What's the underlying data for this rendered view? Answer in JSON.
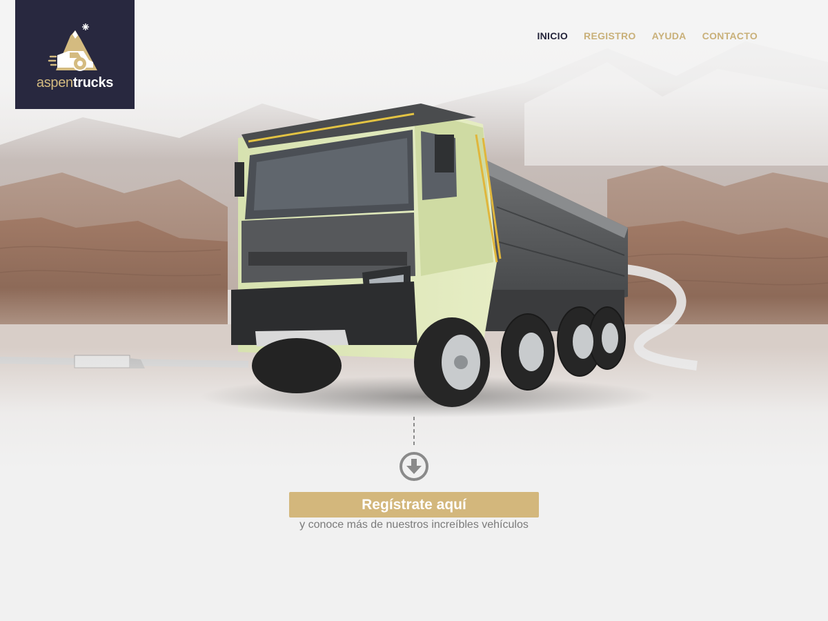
{
  "brand": {
    "name_part1": "aspen",
    "name_part2": "trucks",
    "logo_bg": "#28283f",
    "accent": "#d3b77c"
  },
  "nav": {
    "items": [
      {
        "label": "INICIO",
        "active": true
      },
      {
        "label": "REGISTRO",
        "active": false
      },
      {
        "label": "AYUDA",
        "active": false
      },
      {
        "label": "CONTACTO",
        "active": false
      }
    ]
  },
  "hero": {
    "image": "dump-truck-desert-canyon-photo",
    "scroll_icon": "arrow-down-circle-icon"
  },
  "cta": {
    "button_label": "Regístrate aquí",
    "subtitle": "y conoce más de nuestros increíbles vehículos"
  }
}
